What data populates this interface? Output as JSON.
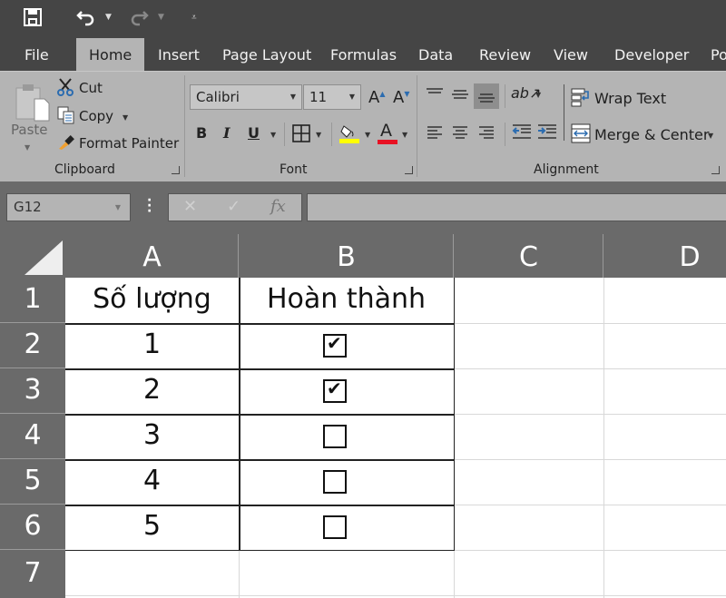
{
  "quick_access": {
    "save_icon": "save-icon",
    "undo_icon": "undo-icon",
    "redo_icon": "redo-icon",
    "customize_icon": "customize-qat-icon"
  },
  "tabs": [
    {
      "label": "File"
    },
    {
      "label": "Home",
      "active": true
    },
    {
      "label": "Insert"
    },
    {
      "label": "Page Layout"
    },
    {
      "label": "Formulas"
    },
    {
      "label": "Data"
    },
    {
      "label": "Review"
    },
    {
      "label": "View"
    },
    {
      "label": "Developer"
    },
    {
      "label": "Po"
    }
  ],
  "ribbon": {
    "clipboard": {
      "paste": "Paste",
      "cut": "Cut",
      "copy": "Copy",
      "format_painter": "Format Painter",
      "group_label": "Clipboard"
    },
    "font": {
      "font_name": "Calibri",
      "font_size": "11",
      "bold": "B",
      "italic": "I",
      "underline": "U",
      "grow": "A",
      "shrink": "A",
      "font_color_letter": "A",
      "fill_color": "#ffff00",
      "font_color": "#e81123",
      "group_label": "Font"
    },
    "alignment": {
      "wrap_text": "Wrap Text",
      "merge_center": "Merge & Center",
      "group_label": "Alignment"
    }
  },
  "formula_bar": {
    "name_box": "G12",
    "cancel": "✕",
    "enter": "✓",
    "fx": "fx",
    "value": ""
  },
  "sheet": {
    "columns": [
      "A",
      "B",
      "C",
      "D"
    ],
    "rows": [
      "1",
      "2",
      "3",
      "4",
      "5",
      "6",
      "7"
    ],
    "header_row": {
      "A": "Số lượng",
      "B": "Hoàn thành"
    },
    "data": [
      {
        "A": "1",
        "B_checked": true
      },
      {
        "A": "2",
        "B_checked": true
      },
      {
        "A": "3",
        "B_checked": false
      },
      {
        "A": "4",
        "B_checked": false
      },
      {
        "A": "5",
        "B_checked": false
      }
    ],
    "check_glyph": "✔"
  }
}
